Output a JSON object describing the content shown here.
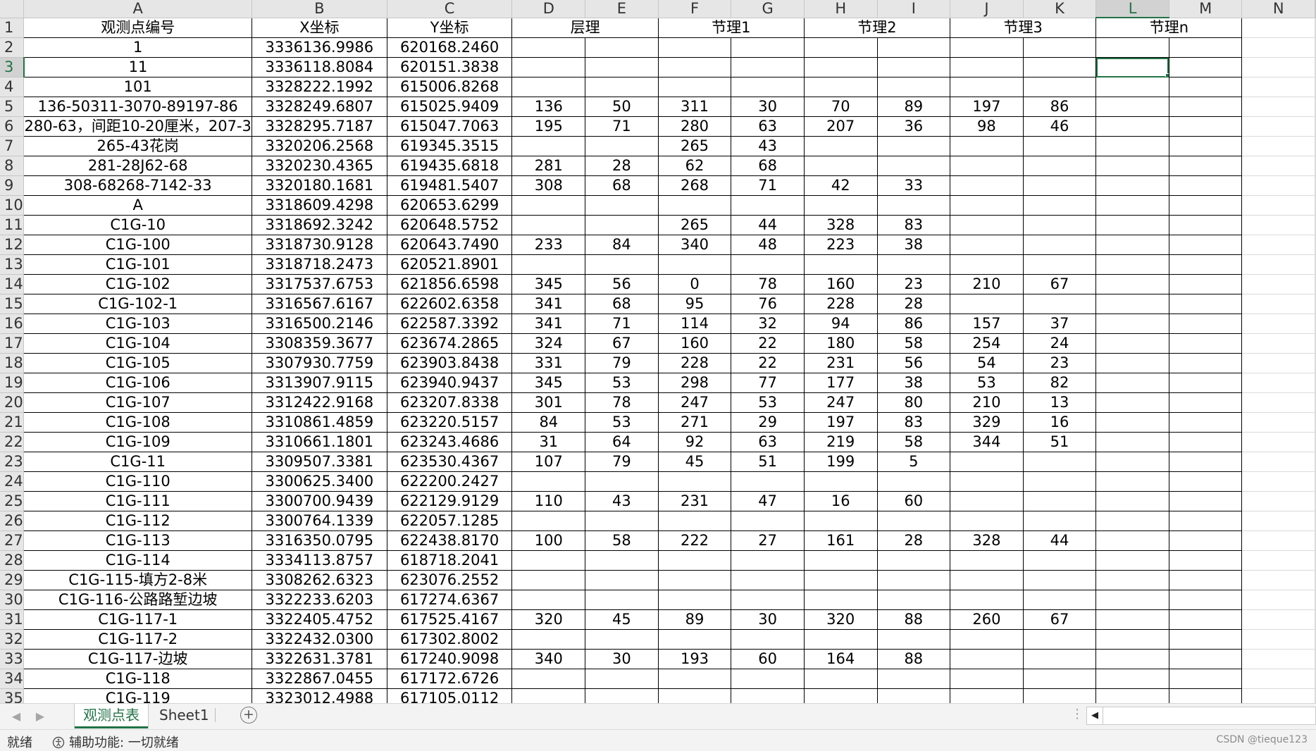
{
  "sheet": {
    "columns": [
      "A",
      "B",
      "C",
      "D",
      "E",
      "F",
      "G",
      "H",
      "I",
      "J",
      "K",
      "L",
      "M",
      "N"
    ],
    "selected_column": "L",
    "selected_row": "3",
    "header_row": {
      "A": "观测点编号",
      "B": "X坐标",
      "C": "Y坐标",
      "DE": "层理",
      "FG": "节理1",
      "HI": "节理2",
      "JK": "节理3",
      "LM": "节理n"
    },
    "rows": [
      {
        "n": "2",
        "a": "1",
        "b": "3336136.9986",
        "c": "620168.2460",
        "d": "",
        "e": "",
        "f": "",
        "g": "",
        "h": "",
        "i": "",
        "j": "",
        "k": ""
      },
      {
        "n": "3",
        "a": "11",
        "b": "3336118.8084",
        "c": "620151.3838",
        "d": "",
        "e": "",
        "f": "",
        "g": "",
        "h": "",
        "i": "",
        "j": "",
        "k": ""
      },
      {
        "n": "4",
        "a": "101",
        "b": "3328222.1992",
        "c": "615006.8268",
        "d": "",
        "e": "",
        "f": "",
        "g": "",
        "h": "",
        "i": "",
        "j": "",
        "k": ""
      },
      {
        "n": "5",
        "a": "136-50311-3070-89197-86",
        "b": "3328249.6807",
        "c": "615025.9409",
        "d": "136",
        "e": "50",
        "f": "311",
        "g": "30",
        "h": "70",
        "i": "89",
        "j": "197",
        "k": "86"
      },
      {
        "n": "6",
        "a": "280-63，间距10-20厘米，207-3",
        "b": "3328295.7187",
        "c": "615047.7063",
        "d": "195",
        "e": "71",
        "f": "280",
        "g": "63",
        "h": "207",
        "i": "36",
        "j": "98",
        "k": "46"
      },
      {
        "n": "7",
        "a": "265-43花岗",
        "b": "3320206.2568",
        "c": "619345.3515",
        "d": "",
        "e": "",
        "f": "265",
        "g": "43",
        "h": "",
        "i": "",
        "j": "",
        "k": ""
      },
      {
        "n": "8",
        "a": "281-28J62-68",
        "b": "3320230.4365",
        "c": "619435.6818",
        "d": "281",
        "e": "28",
        "f": "62",
        "g": "68",
        "h": "",
        "i": "",
        "j": "",
        "k": ""
      },
      {
        "n": "9",
        "a": "308-68268-7142-33",
        "b": "3320180.1681",
        "c": "619481.5407",
        "d": "308",
        "e": "68",
        "f": "268",
        "g": "71",
        "h": "42",
        "i": "33",
        "j": "",
        "k": ""
      },
      {
        "n": "10",
        "a": "A",
        "b": "3318609.4298",
        "c": "620653.6299",
        "d": "",
        "e": "",
        "f": "",
        "g": "",
        "h": "",
        "i": "",
        "j": "",
        "k": ""
      },
      {
        "n": "11",
        "a": "C1G-10",
        "b": "3318692.3242",
        "c": "620648.5752",
        "d": "",
        "e": "",
        "f": "265",
        "g": "44",
        "h": "328",
        "i": "83",
        "j": "",
        "k": ""
      },
      {
        "n": "12",
        "a": "C1G-100",
        "b": "3318730.9128",
        "c": "620643.7490",
        "d": "233",
        "e": "84",
        "f": "340",
        "g": "48",
        "h": "223",
        "i": "38",
        "j": "",
        "k": ""
      },
      {
        "n": "13",
        "a": "C1G-101",
        "b": "3318718.2473",
        "c": "620521.8901",
        "d": "",
        "e": "",
        "f": "",
        "g": "",
        "h": "",
        "i": "",
        "j": "",
        "k": ""
      },
      {
        "n": "14",
        "a": "C1G-102",
        "b": "3317537.6753",
        "c": "621856.6598",
        "d": "345",
        "e": "56",
        "f": "0",
        "g": "78",
        "h": "160",
        "i": "23",
        "j": "210",
        "k": "67"
      },
      {
        "n": "15",
        "a": "C1G-102-1",
        "b": "3316567.6167",
        "c": "622602.6358",
        "d": "341",
        "e": "68",
        "f": "95",
        "g": "76",
        "h": "228",
        "i": "28",
        "j": "",
        "k": ""
      },
      {
        "n": "16",
        "a": "C1G-103",
        "b": "3316500.2146",
        "c": "622587.3392",
        "d": "341",
        "e": "71",
        "f": "114",
        "g": "32",
        "h": "94",
        "i": "86",
        "j": "157",
        "k": "37"
      },
      {
        "n": "17",
        "a": "C1G-104",
        "b": "3308359.3677",
        "c": "623674.2865",
        "d": "324",
        "e": "67",
        "f": "160",
        "g": "22",
        "h": "180",
        "i": "58",
        "j": "254",
        "k": "24"
      },
      {
        "n": "18",
        "a": "C1G-105",
        "b": "3307930.7759",
        "c": "623903.8438",
        "d": "331",
        "e": "79",
        "f": "228",
        "g": "22",
        "h": "231",
        "i": "56",
        "j": "54",
        "k": "23"
      },
      {
        "n": "19",
        "a": "C1G-106",
        "b": "3313907.9115",
        "c": "623940.9437",
        "d": "345",
        "e": "53",
        "f": "298",
        "g": "77",
        "h": "177",
        "i": "38",
        "j": "53",
        "k": "82"
      },
      {
        "n": "20",
        "a": "C1G-107",
        "b": "3312422.9168",
        "c": "623207.8338",
        "d": "301",
        "e": "78",
        "f": "247",
        "g": "53",
        "h": "247",
        "i": "80",
        "j": "210",
        "k": "13"
      },
      {
        "n": "21",
        "a": "C1G-108",
        "b": "3310861.4859",
        "c": "623220.5157",
        "d": "84",
        "e": "53",
        "f": "271",
        "g": "29",
        "h": "197",
        "i": "83",
        "j": "329",
        "k": "16"
      },
      {
        "n": "22",
        "a": "C1G-109",
        "b": "3310661.1801",
        "c": "623243.4686",
        "d": "31",
        "e": "64",
        "f": "92",
        "g": "63",
        "h": "219",
        "i": "58",
        "j": "344",
        "k": "51"
      },
      {
        "n": "23",
        "a": "C1G-11",
        "b": "3309507.3381",
        "c": "623530.4367",
        "d": "107",
        "e": "79",
        "f": "45",
        "g": "51",
        "h": "199",
        "i": "5",
        "j": "",
        "k": ""
      },
      {
        "n": "24",
        "a": "C1G-110",
        "b": "3300625.3400",
        "c": "622200.2427",
        "d": "",
        "e": "",
        "f": "",
        "g": "",
        "h": "",
        "i": "",
        "j": "",
        "k": ""
      },
      {
        "n": "25",
        "a": "C1G-111",
        "b": "3300700.9439",
        "c": "622129.9129",
        "d": "110",
        "e": "43",
        "f": "231",
        "g": "47",
        "h": "16",
        "i": "60",
        "j": "",
        "k": ""
      },
      {
        "n": "26",
        "a": "C1G-112",
        "b": "3300764.1339",
        "c": "622057.1285",
        "d": "",
        "e": "",
        "f": "",
        "g": "",
        "h": "",
        "i": "",
        "j": "",
        "k": ""
      },
      {
        "n": "27",
        "a": "C1G-113",
        "b": "3316350.0795",
        "c": "622438.8170",
        "d": "100",
        "e": "58",
        "f": "222",
        "g": "27",
        "h": "161",
        "i": "28",
        "j": "328",
        "k": "44"
      },
      {
        "n": "28",
        "a": "C1G-114",
        "b": "3334113.8757",
        "c": "618718.2041",
        "d": "",
        "e": "",
        "f": "",
        "g": "",
        "h": "",
        "i": "",
        "j": "",
        "k": ""
      },
      {
        "n": "29",
        "a": "C1G-115-填方2-8米",
        "b": "3308262.6323",
        "c": "623076.2552",
        "d": "",
        "e": "",
        "f": "",
        "g": "",
        "h": "",
        "i": "",
        "j": "",
        "k": ""
      },
      {
        "n": "30",
        "a": "C1G-116-公路路堑边坡",
        "b": "3322233.6203",
        "c": "617274.6367",
        "d": "",
        "e": "",
        "f": "",
        "g": "",
        "h": "",
        "i": "",
        "j": "",
        "k": ""
      },
      {
        "n": "31",
        "a": "C1G-117-1",
        "b": "3322405.4752",
        "c": "617525.4167",
        "d": "320",
        "e": "45",
        "f": "89",
        "g": "30",
        "h": "320",
        "i": "88",
        "j": "260",
        "k": "67"
      },
      {
        "n": "32",
        "a": "C1G-117-2",
        "b": "3322432.0300",
        "c": "617302.8002",
        "d": "",
        "e": "",
        "f": "",
        "g": "",
        "h": "",
        "i": "",
        "j": "",
        "k": ""
      },
      {
        "n": "33",
        "a": "C1G-117-边坡",
        "b": "3322631.3781",
        "c": "617240.9098",
        "d": "340",
        "e": "30",
        "f": "193",
        "g": "60",
        "h": "164",
        "i": "88",
        "j": "",
        "k": ""
      },
      {
        "n": "34",
        "a": "C1G-118",
        "b": "3322867.0455",
        "c": "617172.6726",
        "d": "",
        "e": "",
        "f": "",
        "g": "",
        "h": "",
        "i": "",
        "j": "",
        "k": ""
      },
      {
        "n": "35",
        "a": "C1G-119",
        "b": "3323012.4988",
        "c": "617105.0112",
        "d": "",
        "e": "",
        "f": "",
        "g": "",
        "h": "",
        "i": "",
        "j": "",
        "k": ""
      }
    ]
  },
  "tabs": {
    "items": [
      {
        "label": "观测点表",
        "active": true
      },
      {
        "label": "Sheet1",
        "active": false
      }
    ],
    "add_label": "+",
    "prev_arrow": "◀",
    "next_arrow": "▶",
    "dots": "⋮",
    "scroll_left": "◀"
  },
  "status": {
    "ready": "就绪",
    "accessibility": "辅助功能: 一切就绪",
    "access_icon": "accessibility-icon",
    "watermark": "CSDN @tieque123"
  },
  "colors": {
    "accent": "#217346",
    "header_bg": "#e6e6e6",
    "gridline": "#dadada"
  }
}
